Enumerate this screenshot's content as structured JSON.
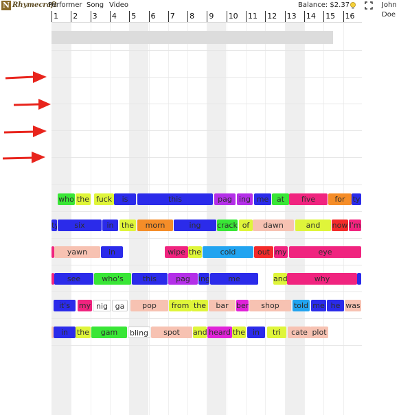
{
  "app": {
    "logo_text": "Rhymecraft",
    "menu": [
      "Performer",
      "Song",
      "Video"
    ],
    "balance": "Balance: $2.37",
    "user": "John Doe"
  },
  "icons": {
    "lightbulb": "lightbulb-icon",
    "fullscreen": "fullscreen-icon",
    "arrow": "arrow-right-icon"
  },
  "colors": {
    "blue": "#2b2bea",
    "green": "#39e636",
    "yellow": "#dff53a",
    "purple": "#b42fe8",
    "pink": "#f0247f",
    "orange": "#f58d28",
    "sky": "#22a4f0",
    "salmon": "#f7c2b2",
    "red": "#f42a2a",
    "magenta": "#e022d8",
    "white": "#ffffff"
  },
  "ruler": [
    "1",
    "2",
    "3",
    "4",
    "5",
    "6",
    "7",
    "8",
    "9",
    "10",
    "11",
    "12",
    "13",
    "14",
    "15",
    "16"
  ],
  "lyrics": [
    [
      {
        "t": "who",
        "c": "green"
      },
      {
        "t": "the",
        "c": "yellow"
      },
      {
        "t": "fuck",
        "c": "yellow"
      },
      {
        "t": "is",
        "c": "blue"
      },
      {
        "t": "this",
        "c": "blue"
      },
      {
        "t": "pag",
        "c": "purple"
      },
      {
        "t": "ing",
        "c": "purple"
      },
      {
        "t": "me",
        "c": "blue"
      },
      {
        "t": "at",
        "c": "green"
      },
      {
        "t": "five",
        "c": "pink"
      },
      {
        "t": "for",
        "c": "orange"
      },
      {
        "t": "ty",
        "c": "blue"
      }
    ],
    [
      {
        "t": "ty",
        "c": "blue"
      },
      {
        "t": "six",
        "c": "blue"
      },
      {
        "t": "in",
        "c": "blue"
      },
      {
        "t": "the",
        "c": "yellow"
      },
      {
        "t": "morn",
        "c": "orange"
      },
      {
        "t": "ing",
        "c": "blue"
      },
      {
        "t": "crack",
        "c": "green"
      },
      {
        "t": "of",
        "c": "yellow"
      },
      {
        "t": "dawn",
        "c": "salmon"
      },
      {
        "t": "and",
        "c": "yellow"
      },
      {
        "t": "now",
        "c": "red"
      },
      {
        "t": "I'm",
        "c": "pink"
      }
    ],
    [
      {
        "t": "",
        "c": "pink"
      },
      {
        "t": "yawn",
        "c": "salmon"
      },
      {
        "t": "in",
        "c": "blue"
      },
      {
        "t": "wipe",
        "c": "pink"
      },
      {
        "t": "the",
        "c": "yellow"
      },
      {
        "t": "cold",
        "c": "sky"
      },
      {
        "t": "out",
        "c": "red"
      },
      {
        "t": "my",
        "c": "pink"
      },
      {
        "t": "eye",
        "c": "pink"
      }
    ],
    [
      {
        "t": "",
        "c": "pink"
      },
      {
        "t": "see",
        "c": "blue"
      },
      {
        "t": "who's",
        "c": "green"
      },
      {
        "t": "this",
        "c": "blue"
      },
      {
        "t": "pag",
        "c": "purple"
      },
      {
        "t": "ing",
        "c": "blue"
      },
      {
        "t": "me",
        "c": "blue"
      },
      {
        "t": "and",
        "c": "yellow"
      },
      {
        "t": "why",
        "c": "pink"
      },
      {
        "t": "",
        "c": "blue"
      }
    ],
    [
      {
        "t": "it's",
        "c": "blue"
      },
      {
        "t": "my",
        "c": "pink"
      },
      {
        "t": "nig",
        "c": "white"
      },
      {
        "t": "ga",
        "c": "white"
      },
      {
        "t": "pop",
        "c": "salmon"
      },
      {
        "t": "from",
        "c": "yellow"
      },
      {
        "t": "the",
        "c": "yellow"
      },
      {
        "t": "bar",
        "c": "salmon"
      },
      {
        "t": "ber",
        "c": "magenta"
      },
      {
        "t": "shop",
        "c": "salmon"
      },
      {
        "t": "told",
        "c": "sky"
      },
      {
        "t": "me",
        "c": "blue"
      },
      {
        "t": "he",
        "c": "blue"
      },
      {
        "t": "was",
        "c": "salmon"
      }
    ],
    [
      {
        "t": "",
        "c": "salmon"
      },
      {
        "t": "in",
        "c": "blue"
      },
      {
        "t": "the",
        "c": "yellow"
      },
      {
        "t": "gam",
        "c": "green"
      },
      {
        "t": "bling",
        "c": "white"
      },
      {
        "t": "spot",
        "c": "salmon"
      },
      {
        "t": "and",
        "c": "yellow"
      },
      {
        "t": "heard",
        "c": "magenta"
      },
      {
        "t": "the",
        "c": "yellow"
      },
      {
        "t": "in",
        "c": "blue"
      },
      {
        "t": "tri",
        "c": "yellow"
      },
      {
        "t": "cate",
        "c": "salmon"
      },
      {
        "t": "plot",
        "c": "salmon"
      }
    ]
  ]
}
